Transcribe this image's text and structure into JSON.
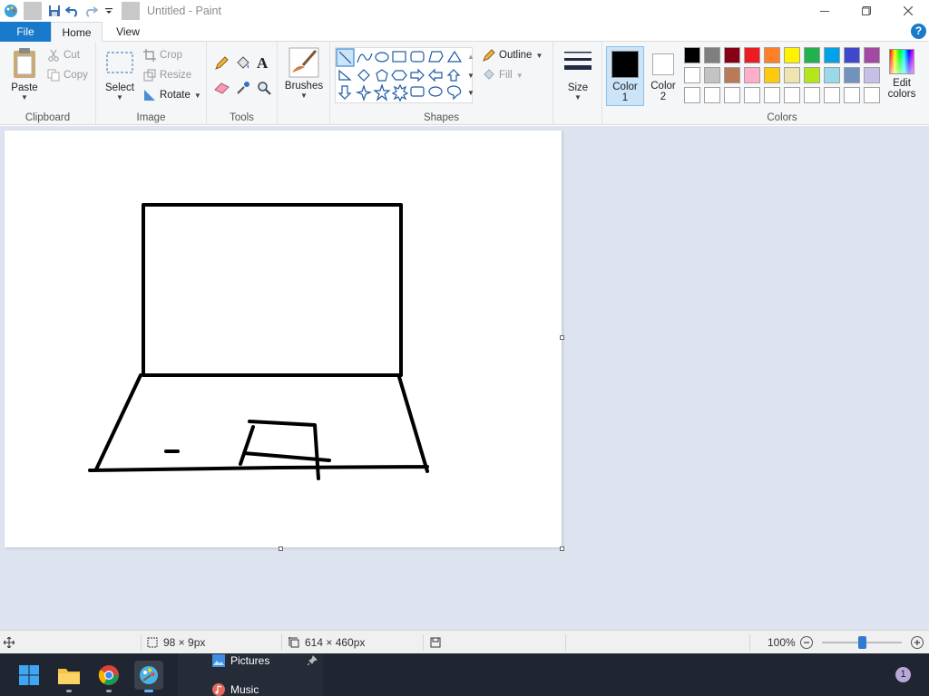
{
  "window": {
    "title": "Untitled - Paint"
  },
  "tabs": {
    "file": "File",
    "home": "Home",
    "view": "View"
  },
  "ribbon": {
    "clipboard": {
      "label": "Clipboard",
      "paste": "Paste",
      "cut": "Cut",
      "copy": "Copy"
    },
    "image": {
      "label": "Image",
      "select": "Select",
      "crop": "Crop",
      "resize": "Resize",
      "rotate": "Rotate"
    },
    "tools": {
      "label": "Tools"
    },
    "brushes": {
      "label": "Brushes"
    },
    "shapes": {
      "label": "Shapes",
      "outline": "Outline",
      "fill": "Fill"
    },
    "size": {
      "label": "Size"
    },
    "color1": {
      "line1": "Color",
      "line2": "1",
      "value": "#000000"
    },
    "color2": {
      "line1": "Color",
      "line2": "2",
      "value": "#ffffff"
    },
    "colors": {
      "label": "Colors",
      "edit_line1": "Edit",
      "edit_line2": "colors",
      "row1": [
        "#000000",
        "#7f7f7f",
        "#880015",
        "#ed1c24",
        "#ff7f27",
        "#fff200",
        "#22b14c",
        "#00a2e8",
        "#3f48cc",
        "#a349a4"
      ],
      "row2": [
        "#ffffff",
        "#c3c3c3",
        "#b97a57",
        "#ffaec9",
        "#ffc90e",
        "#efe4b0",
        "#b5e61d",
        "#99d9ea",
        "#7092be",
        "#c8bfe7"
      ],
      "row3": [
        "#ffffff",
        "#ffffff",
        "#ffffff",
        "#ffffff",
        "#ffffff",
        "#ffffff",
        "#ffffff",
        "#ffffff",
        "#ffffff",
        "#ffffff"
      ]
    }
  },
  "status": {
    "selection_size": "98 × 9px",
    "canvas_size": "614 × 460px",
    "zoom": "100%"
  },
  "taskbar": {
    "jump_pictures": "Pictures",
    "jump_music": "Music",
    "notification_count": "1"
  }
}
